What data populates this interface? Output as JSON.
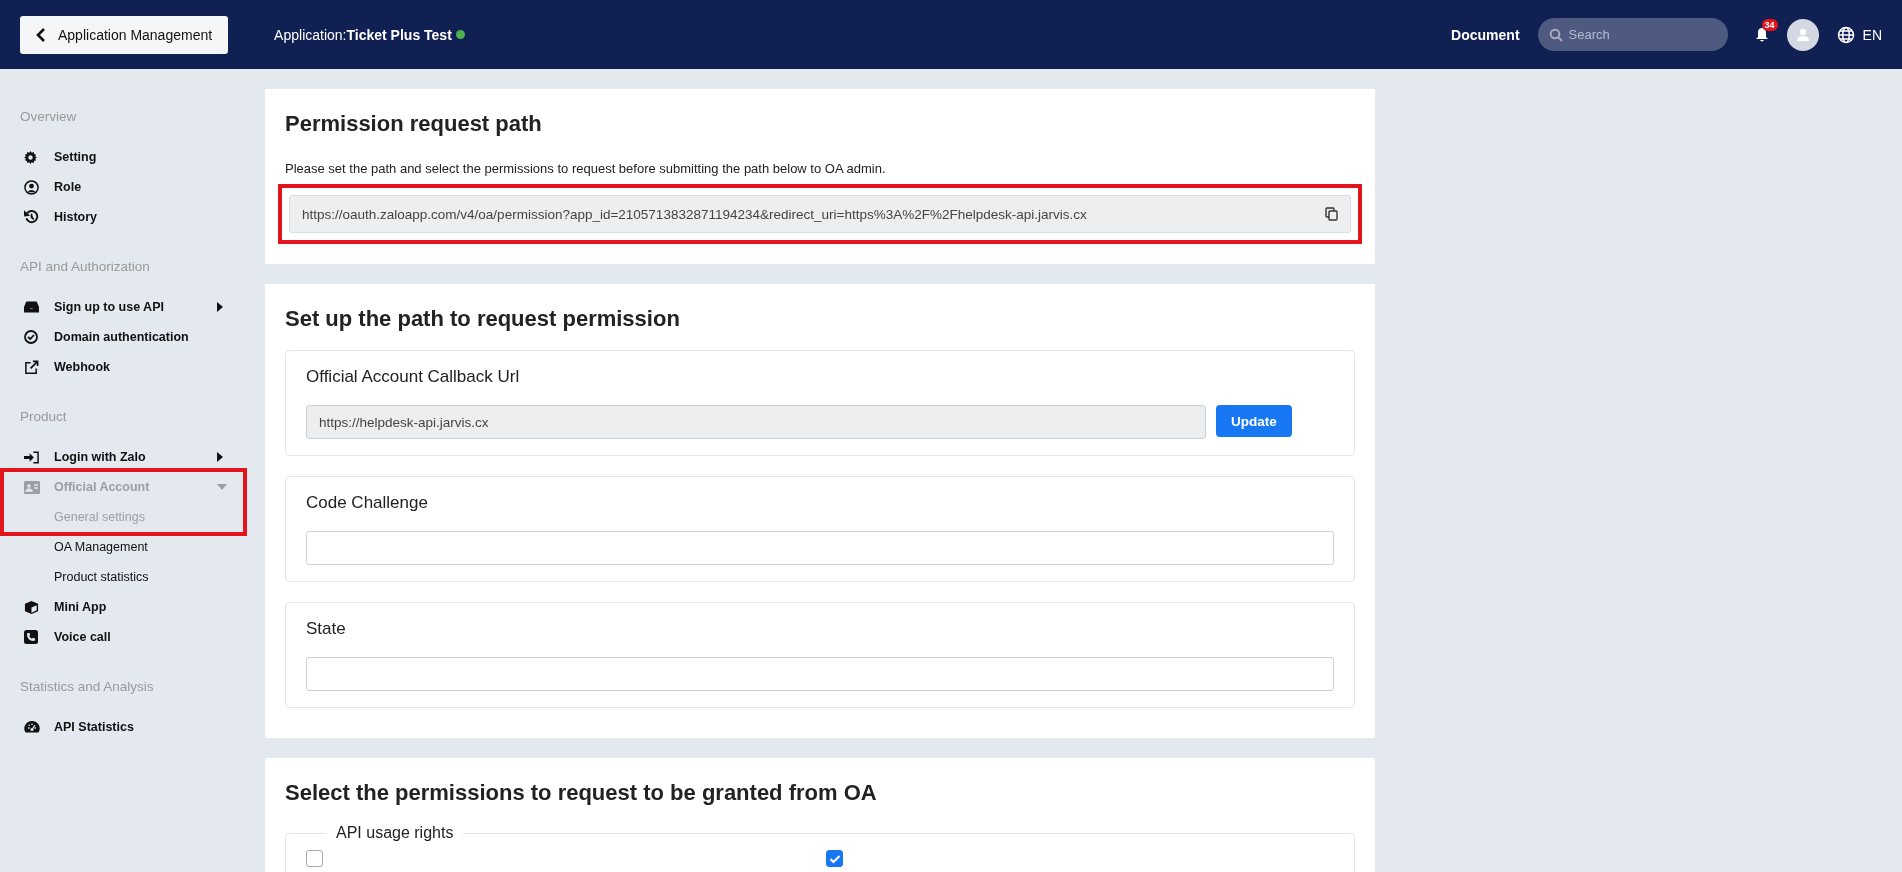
{
  "top_bar": {
    "back_button": "Application Management",
    "app_label": "Application:",
    "app_name": "Ticket Plus Test",
    "app_online": true,
    "document_link": "Document",
    "search": {
      "placeholder": "Search"
    },
    "notification_count": "34",
    "language": "EN"
  },
  "sidebar": {
    "sections": [
      {
        "title": "Overview",
        "items": [
          {
            "label": "Setting",
            "active": false
          },
          {
            "label": "Role",
            "active": false
          },
          {
            "label": "History",
            "active": false
          }
        ]
      },
      {
        "title": "API and Authorization",
        "items": [
          {
            "label": "Sign up to use API",
            "active": false,
            "kind": "submenu",
            "expanded": false
          },
          {
            "label": "Domain authentication",
            "active": false
          },
          {
            "label": "Webhook",
            "active": false
          }
        ]
      },
      {
        "title": "Product",
        "items": [
          {
            "label": "Login with Zalo",
            "active": false,
            "kind": "submenu",
            "expanded": false
          },
          {
            "label": "Official Account",
            "active": true,
            "highlighted": true,
            "kind": "submenu",
            "expanded": true,
            "children": [
              {
                "label": "General settings",
                "active": true
              },
              {
                "label": "OA Management",
                "active": false
              },
              {
                "label": "Product statistics",
                "active": false
              }
            ]
          },
          {
            "label": "Mini App",
            "active": false
          },
          {
            "label": "Voice call",
            "active": false
          }
        ]
      },
      {
        "title": "Statistics and Analysis",
        "items": [
          {
            "label": "API Statistics",
            "active": false
          }
        ]
      }
    ]
  },
  "permission_path_card": {
    "title": "Permission request path",
    "description": "Please set the path and select the permissions to request before submitting the path below to OA admin.",
    "url": "https://oauth.zaloapp.com/v4/oa/permission?app_id=2105713832871194234&redirect_uri=https%3A%2F%2Fhelpdesk-api.jarvis.cx",
    "highlighted": true
  },
  "setup_card": {
    "title": "Set up the path to request permission",
    "sections": [
      {
        "label": "Official Account Callback Url",
        "value": "https://helpdesk-api.jarvis.cx",
        "button": "Update"
      },
      {
        "label": "Code Challenge"
      },
      {
        "label": "State"
      }
    ]
  },
  "permissions_card": {
    "title": "Select the permissions to request to be granted from OA",
    "group_title": "API usage rights",
    "checkboxes": [
      {
        "checked": false
      },
      {
        "checked": true
      }
    ]
  }
}
